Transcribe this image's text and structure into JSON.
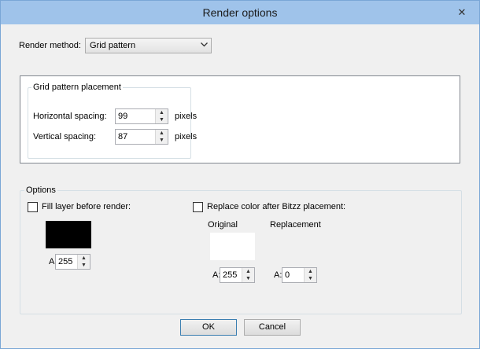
{
  "window": {
    "title": "Render options",
    "close_glyph": "✕"
  },
  "render_method": {
    "label": "Render method:",
    "selected": "Grid pattern"
  },
  "grid_placement": {
    "group_label": "Grid pattern placement",
    "horizontal": {
      "label": "Horizontal spacing:",
      "value": "99",
      "unit": "pixels"
    },
    "vertical": {
      "label": "Vertical spacing:",
      "value": "87",
      "unit": "pixels"
    }
  },
  "options": {
    "group_label": "Options",
    "fill_layer": {
      "label": "Fill layer before render:",
      "checked": false,
      "color": "#000000",
      "alpha_label": "A:",
      "alpha": "255"
    },
    "replace_color": {
      "label": "Replace color after Bitzz placement:",
      "checked": false,
      "original": {
        "label": "Original",
        "color": "#ffffff",
        "alpha_label": "A:",
        "alpha": "255"
      },
      "replacement": {
        "label": "Replacement",
        "alpha_label": "A:",
        "alpha": "0"
      }
    }
  },
  "buttons": {
    "ok": "OK",
    "cancel": "Cancel"
  },
  "icons": {
    "spin_up": "▲",
    "spin_down": "▼",
    "dropdown": "⌄"
  }
}
